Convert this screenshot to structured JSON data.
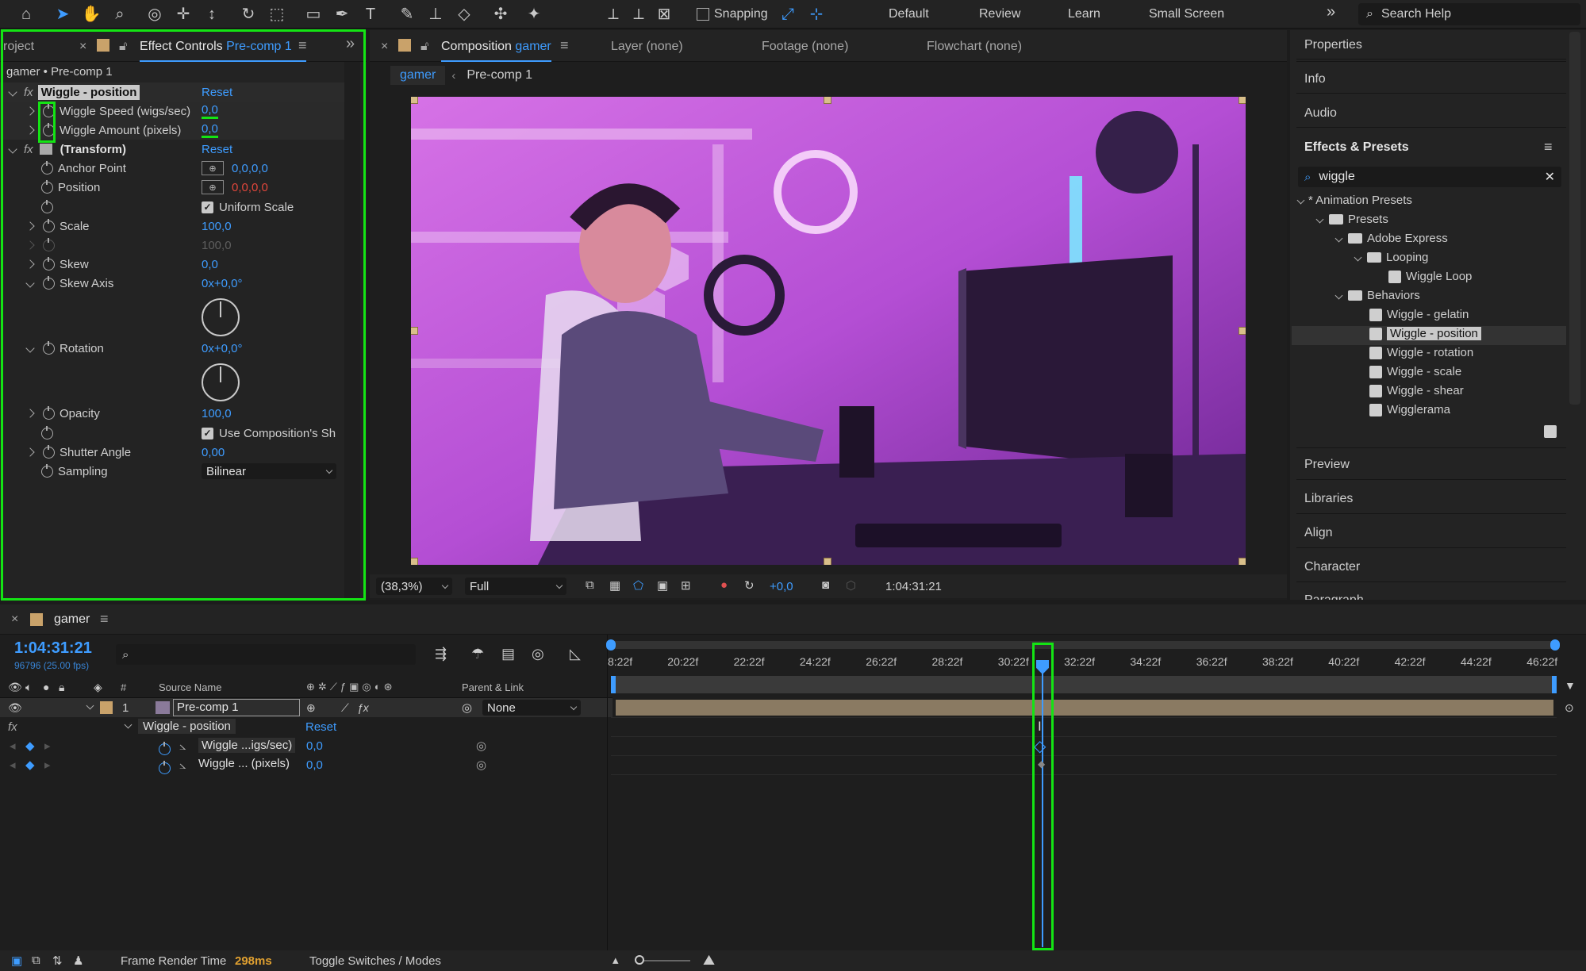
{
  "toolbar": {
    "snapping_label": "Snapping",
    "workspaces": [
      "Default",
      "Review",
      "Learn",
      "Small Screen"
    ],
    "search_placeholder": "Search Help"
  },
  "left_panel": {
    "project_tab": "roject",
    "effect_tab_label": "Effect Controls",
    "effect_tab_target": "Pre-comp 1",
    "subtitle": "gamer • Pre-comp 1",
    "wiggle": {
      "name": "Wiggle - position",
      "reset": "Reset",
      "speed_label": "Wiggle Speed (wigs/sec)",
      "speed_value": "0,0",
      "amount_label": "Wiggle Amount (pixels)",
      "amount_value": "0,0"
    },
    "transform": {
      "name": "(Transform)",
      "reset": "Reset",
      "anchor_label": "Anchor Point",
      "anchor_value": "0,0,0,0",
      "position_label": "Position",
      "position_value": "0,0,0,0",
      "uniform_scale": "Uniform Scale",
      "scale_label": "Scale",
      "scale_value": "100,0",
      "scale_value2": "100,0",
      "skew_label": "Skew",
      "skew_value": "0,0",
      "skew_axis_label": "Skew Axis",
      "skew_axis_value": "0x+0,0°",
      "rotation_label": "Rotation",
      "rotation_value": "0x+0,0°",
      "opacity_label": "Opacity",
      "opacity_value": "100,0",
      "use_comp_shutter": "Use Composition's Sh",
      "shutter_label": "Shutter Angle",
      "shutter_value": "0,00",
      "sampling_label": "Sampling",
      "sampling_value": "Bilinear"
    }
  },
  "comp_panel": {
    "comp_tab_label": "Composition",
    "comp_tab_target": "gamer",
    "layer_tab": "Layer (none)",
    "footage_tab": "Footage (none)",
    "flowchart_tab": "Flowchart (none)",
    "crumb_active": "gamer",
    "crumb_next": "Pre-comp 1",
    "zoom": "(38,3%)",
    "resolution": "Full",
    "exposure": "+0,0",
    "timecode": "1:04:31:21"
  },
  "right_panel": {
    "sections_top": [
      "Properties",
      "Info",
      "Audio"
    ],
    "effects_title": "Effects & Presets",
    "search_value": "wiggle",
    "tree": {
      "animation_presets": "* Animation Presets",
      "presets": "Presets",
      "adobe_express": "Adobe Express",
      "looping": "Looping",
      "wiggle_loop": "Wiggle Loop",
      "behaviors": "Behaviors",
      "items": [
        "Wiggle - gelatin",
        "Wiggle - position",
        "Wiggle - rotation",
        "Wiggle - scale",
        "Wiggle - shear",
        "Wigglerama"
      ]
    },
    "sections_bottom": [
      "Preview",
      "Libraries",
      "Align",
      "Character",
      "Paragraph"
    ]
  },
  "timeline": {
    "tab_label": "gamer",
    "timecode": "1:04:31:21",
    "frames": "96796 (25.00 fps)",
    "col_num": "#",
    "col_source": "Source Name",
    "col_parent": "Parent & Link",
    "layer_num": "1",
    "layer_name": "Pre-comp 1",
    "parent_value": "None",
    "fx_label": "fx",
    "effect_name": "Wiggle - position",
    "effect_reset": "Reset",
    "prop1_label": "Wiggle ...igs/sec)",
    "prop1_value": "0,0",
    "prop2_label": "Wiggle ... (pixels)",
    "prop2_value": "0,0",
    "ticks": [
      "8:22f",
      "20:22f",
      "22:22f",
      "24:22f",
      "26:22f",
      "28:22f",
      "30:22f",
      "32:22f",
      "34:22f",
      "36:22f",
      "38:22f",
      "40:22f",
      "42:22f",
      "44:22f",
      "46:22f"
    ]
  },
  "status_bar": {
    "render_label": "Frame Render Time",
    "render_value": "298ms",
    "toggle_label": "Toggle Switches / Modes"
  }
}
